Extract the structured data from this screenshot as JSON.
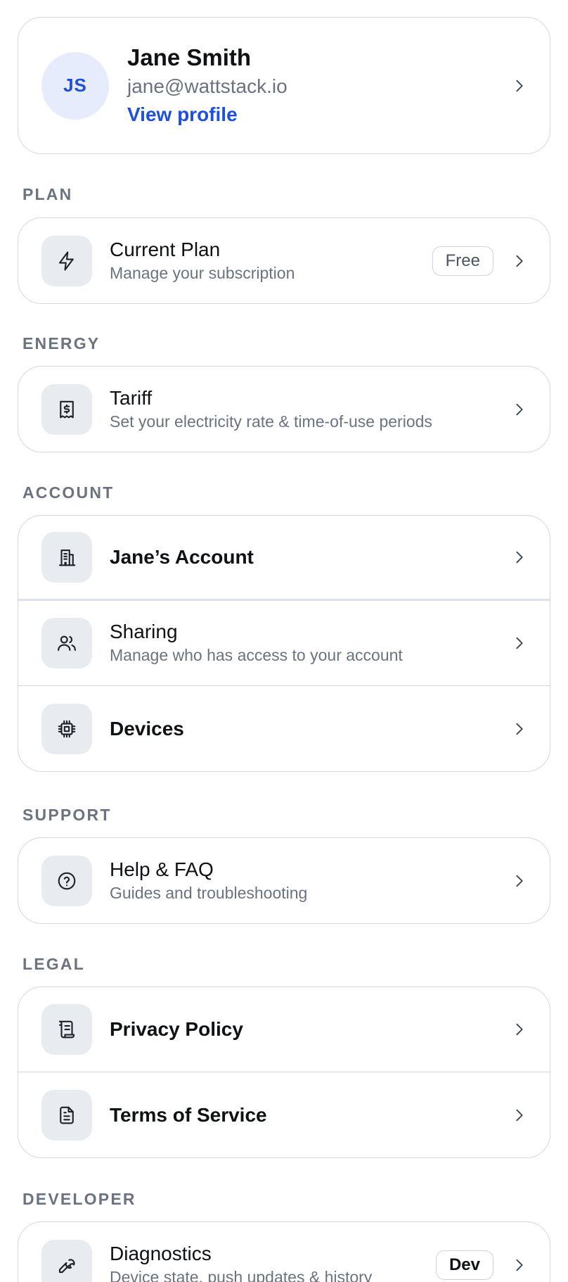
{
  "profile": {
    "initials": "JS",
    "name": "Jane Smith",
    "email": "jane@wattstack.io",
    "link": "View profile"
  },
  "sections": {
    "plan": {
      "label": "PLAN",
      "items": [
        {
          "title": "Current Plan",
          "subtitle": "Manage your subscription",
          "badge": "Free",
          "icon": "lightning-icon"
        }
      ]
    },
    "energy": {
      "label": "ENERGY",
      "items": [
        {
          "title": "Tariff",
          "subtitle": "Set your electricity rate & time-of-use periods",
          "icon": "receipt-dollar-icon"
        }
      ]
    },
    "account": {
      "label": "ACCOUNT",
      "items": [
        {
          "title": "Jane’s Account",
          "icon": "building-icon"
        },
        {
          "title": "Sharing",
          "subtitle": "Manage who has access to your account",
          "icon": "users-icon"
        },
        {
          "title": "Devices",
          "icon": "chip-icon"
        }
      ]
    },
    "support": {
      "label": "SUPPORT",
      "items": [
        {
          "title": "Help & FAQ",
          "subtitle": "Guides and troubleshooting",
          "icon": "help-circle-icon"
        }
      ]
    },
    "legal": {
      "label": "LEGAL",
      "items": [
        {
          "title": "Privacy Policy",
          "icon": "scroll-icon"
        },
        {
          "title": "Terms of Service",
          "icon": "document-icon"
        }
      ]
    },
    "developer": {
      "label": "DEVELOPER",
      "items": [
        {
          "title": "Diagnostics",
          "subtitle": "Device state, push updates & history",
          "badge": "Dev",
          "icon": "wrench-icon"
        }
      ]
    }
  },
  "colors": {
    "accent": "#1d4fe0",
    "avatar_bg": "#e7ecfc",
    "muted_text": "#6b7280",
    "border": "#d4d7de",
    "icon_bg": "#e8ebef"
  }
}
